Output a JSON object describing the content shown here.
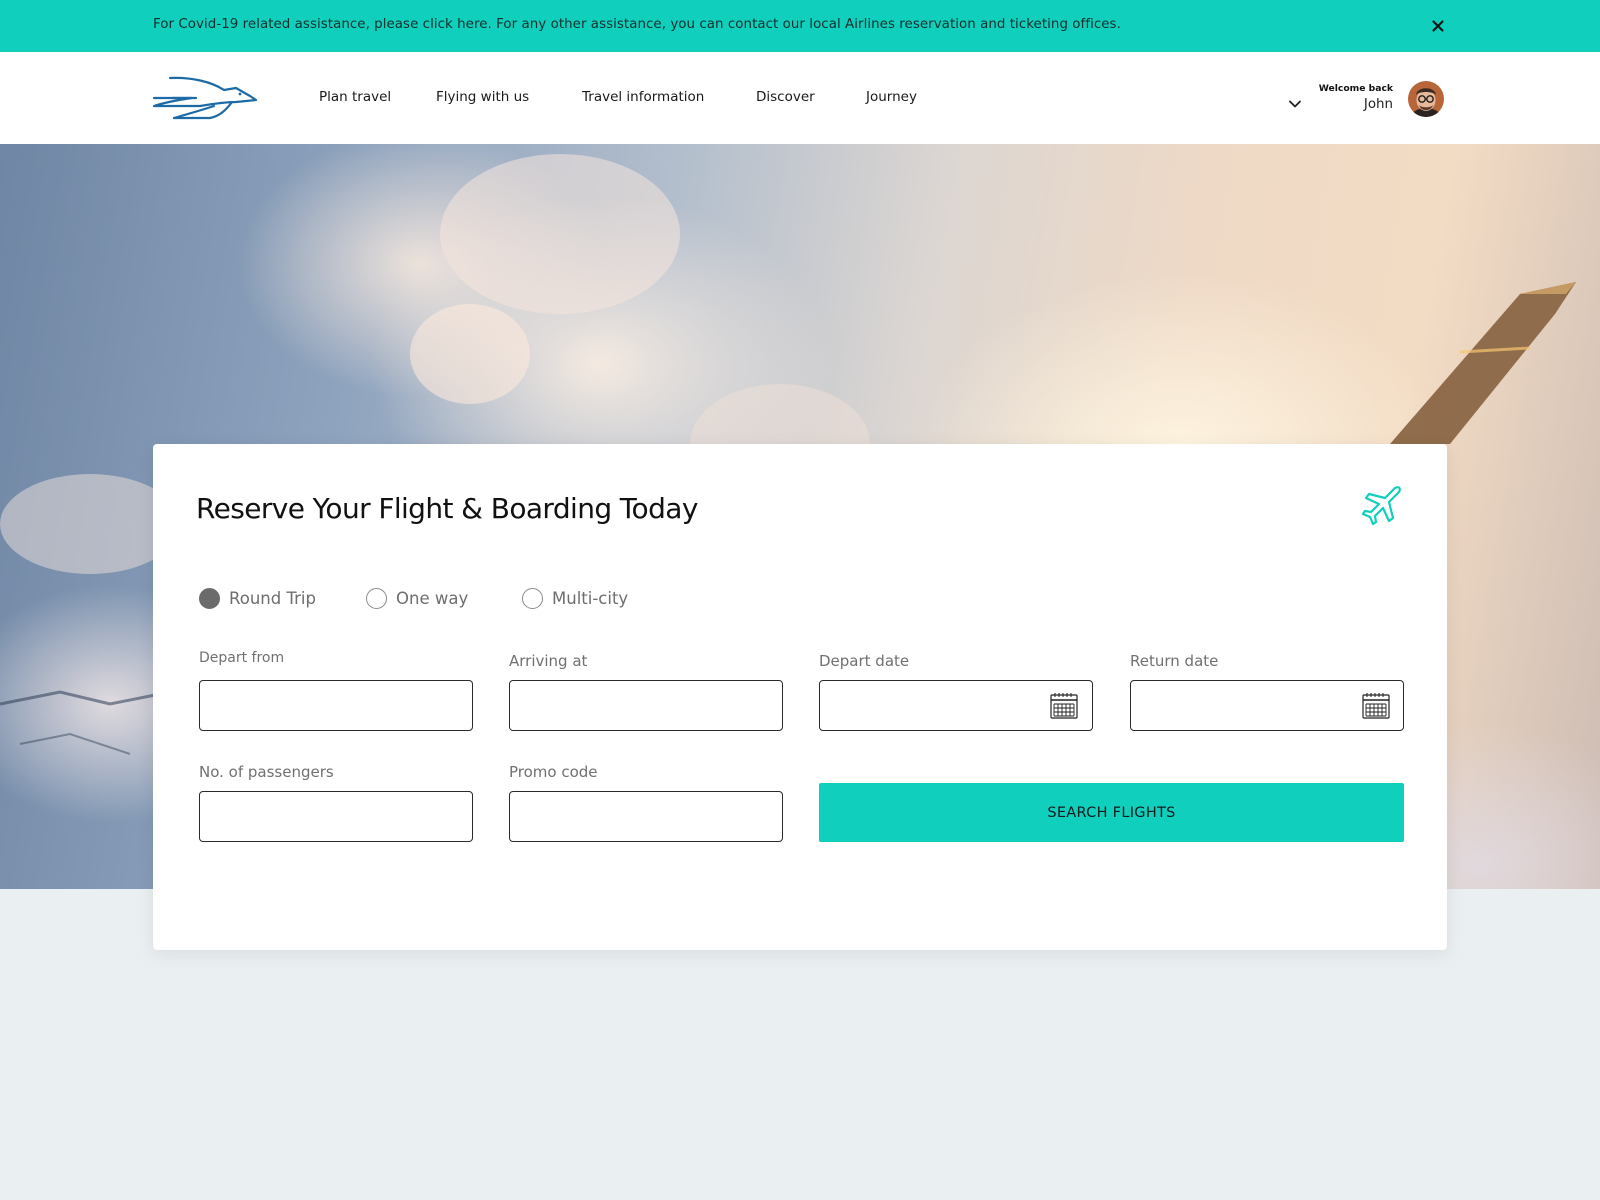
{
  "banner": {
    "text": "For Covid-19 related assistance, please click here. For any other assistance, you can contact our local Airlines reservation and ticketing offices.",
    "close_icon": "close-icon"
  },
  "nav": {
    "items": [
      {
        "label": "Plan travel"
      },
      {
        "label": "Flying with us"
      },
      {
        "label": "Travel information"
      },
      {
        "label": "Discover"
      },
      {
        "label": "Journey"
      }
    ]
  },
  "user": {
    "welcome": "Welcome back",
    "name": "John"
  },
  "booking": {
    "title": "Reserve Your Flight & Boarding Today",
    "trip_types": [
      {
        "label": "Round Trip",
        "selected": true
      },
      {
        "label": "One way",
        "selected": false
      },
      {
        "label": "Multi-city",
        "selected": false
      }
    ],
    "fields": {
      "depart_from": {
        "label": "Depart from",
        "value": ""
      },
      "arriving_at": {
        "label": "Arriving at",
        "value": ""
      },
      "depart_date": {
        "label": "Depart date",
        "value": ""
      },
      "return_date": {
        "label": "Return date",
        "value": ""
      },
      "passengers": {
        "label": "No. of passengers",
        "value": ""
      },
      "promo_code": {
        "label": "Promo code",
        "value": ""
      }
    },
    "search_label": "SEARCH FLIGHTS"
  },
  "colors": {
    "accent": "#10cfbd",
    "logo": "#1c6aa6",
    "page_bg": "#eaeff2"
  }
}
